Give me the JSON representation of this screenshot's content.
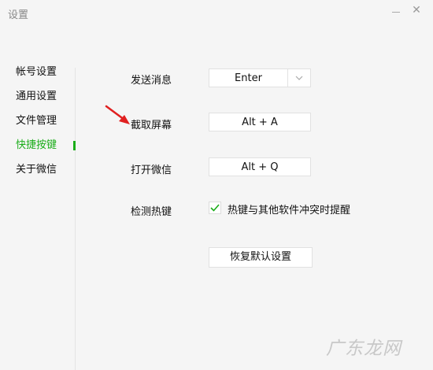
{
  "window": {
    "title": "设置",
    "minimize_icon": "minimize-icon",
    "close_icon": "close-icon"
  },
  "sidebar": {
    "items": [
      {
        "label": "帐号设置",
        "active": false
      },
      {
        "label": "通用设置",
        "active": false
      },
      {
        "label": "文件管理",
        "active": false
      },
      {
        "label": "快捷按键",
        "active": true
      },
      {
        "label": "关于微信",
        "active": false
      }
    ],
    "active_color": "#1aad19"
  },
  "shortcuts": {
    "send_message": {
      "label": "发送消息",
      "value": "Enter",
      "arrow_icon": "chevron-down-icon"
    },
    "screenshot": {
      "label": "截取屏幕",
      "value": "Alt + A"
    },
    "open_wechat": {
      "label": "打开微信",
      "value": "Alt + Q"
    },
    "detect_hotkey": {
      "label": "检测热键",
      "checkbox_label": "热键与其他软件冲突时提醒",
      "checked": true
    },
    "reset_label": "恢复默认设置"
  },
  "annotation": {
    "icon": "red-arrow-icon",
    "color": "#e02020"
  },
  "watermark": {
    "text": "广东龙网"
  }
}
